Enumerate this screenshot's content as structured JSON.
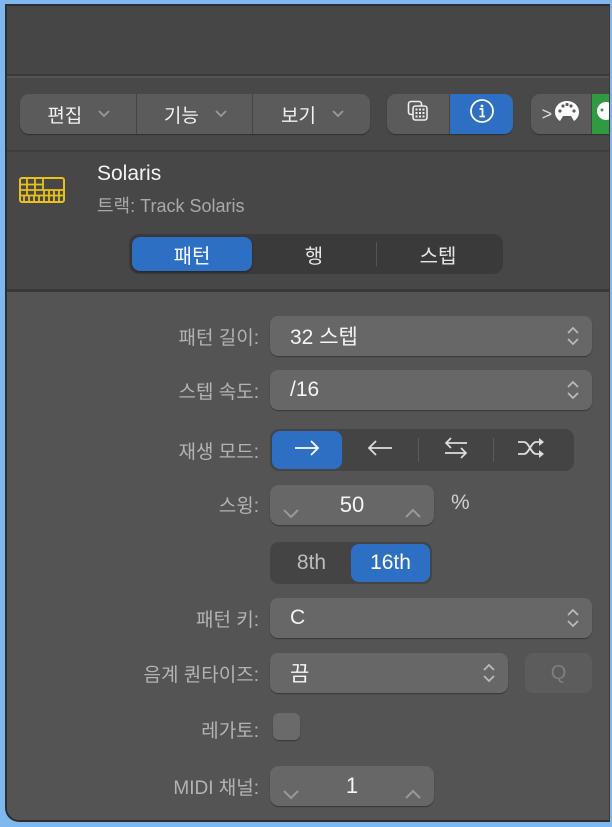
{
  "toolbar": {
    "menus": [
      {
        "label": "편집",
        "icon": "chevron-down-icon"
      },
      {
        "label": "기능",
        "icon": "chevron-down-icon"
      },
      {
        "label": "보기",
        "icon": "chevron-down-icon"
      }
    ],
    "view_buttons": [
      {
        "name": "step-grid-view",
        "icon": "grid-windows-icon",
        "active": false
      },
      {
        "name": "inspector",
        "icon": "info-icon",
        "active": true
      }
    ],
    "library_buttons": [
      {
        "name": "midi-output",
        "icon": "midi-port-icon",
        "prefix": ">"
      },
      {
        "name": "green-partial",
        "icon": "midi-port-icon"
      }
    ],
    "colors": {
      "accent": "#2d6fc2",
      "green": "#2f9a41"
    }
  },
  "header": {
    "track_icon": "step-sequencer-icon",
    "track_icon_color": "#e8c21a",
    "title": "Solaris",
    "subtitle": "트랙: Track Solaris",
    "tabs": [
      {
        "label": "패턴",
        "active": true
      },
      {
        "label": "행",
        "active": false
      },
      {
        "label": "스텝",
        "active": false
      }
    ]
  },
  "settings": {
    "pattern_length": {
      "label": "패턴 길이:",
      "value": "32 스텝"
    },
    "step_rate": {
      "label": "스텝 속도:",
      "value": "/16"
    },
    "playback_mode": {
      "label": "재생 모드:",
      "options": [
        {
          "name": "forward",
          "icon": "arrow-right-icon",
          "active": true
        },
        {
          "name": "reverse",
          "icon": "arrow-left-icon",
          "active": false
        },
        {
          "name": "ping-pong",
          "icon": "arrows-swap-icon",
          "active": false
        },
        {
          "name": "random",
          "icon": "shuffle-icon",
          "active": false
        }
      ]
    },
    "swing": {
      "label": "스윙:",
      "value": "50",
      "unit": "%"
    },
    "swing_resolution": {
      "options": [
        {
          "label": "8th",
          "active": false
        },
        {
          "label": "16th",
          "active": true
        }
      ]
    },
    "pattern_key": {
      "label": "패턴 키:",
      "value": "C"
    },
    "scale_quantize": {
      "label": "음계 퀀타이즈:",
      "value": "끔",
      "q_button": "Q"
    },
    "legato": {
      "label": "레가토:",
      "checked": false
    },
    "midi_channel": {
      "label": "MIDI 채널:",
      "value": "1"
    }
  }
}
